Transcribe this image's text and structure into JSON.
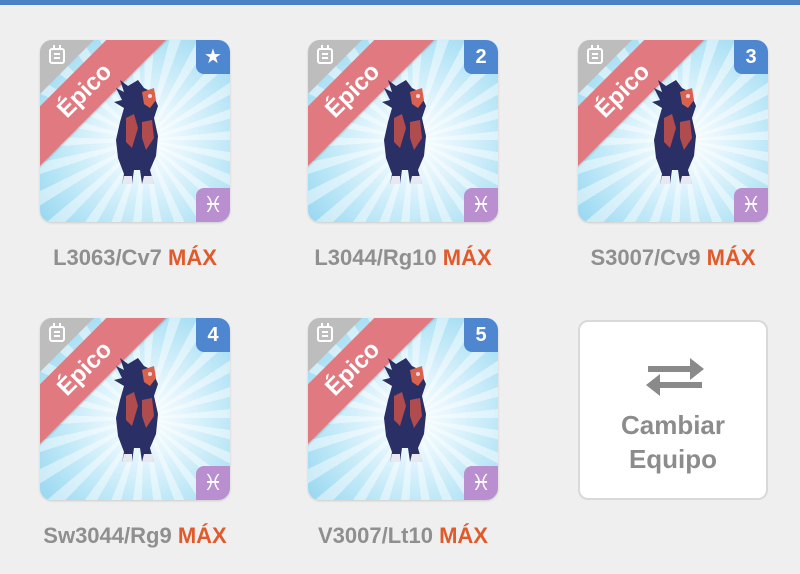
{
  "team": {
    "slots": [
      {
        "rarity": "Épico",
        "badge": "★",
        "name": "L3063/Cv7",
        "max": "MÁX",
        "zodiac": "♓"
      },
      {
        "rarity": "Épico",
        "badge": "2",
        "name": "L3044/Rg10",
        "max": "MÁX",
        "zodiac": "♓"
      },
      {
        "rarity": "Épico",
        "badge": "3",
        "name": "S3007/Cv9",
        "max": "MÁX",
        "zodiac": "♓"
      },
      {
        "rarity": "Épico",
        "badge": "4",
        "name": "Sw3044/Rg9",
        "max": "MÁX",
        "zodiac": "♓"
      },
      {
        "rarity": "Épico",
        "badge": "5",
        "name": "V3007/Lt10",
        "max": "MÁX",
        "zodiac": "♓"
      }
    ]
  },
  "swap_button": {
    "line1": "Cambiar",
    "line2": "Equipo"
  },
  "colors": {
    "rarity_ribbon": "#e07a80",
    "badge": "#4f86d0",
    "zodiac": "#b98fd0",
    "max_text": "#e05a2b",
    "name_text": "#8f8f8f"
  }
}
